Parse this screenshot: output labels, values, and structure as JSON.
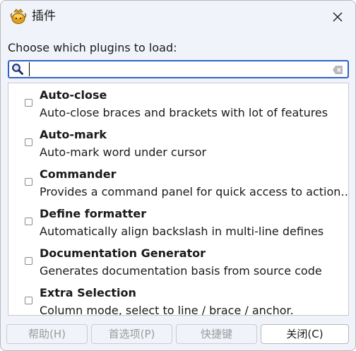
{
  "window": {
    "title": "插件",
    "close_label": "✕"
  },
  "prompt": "Choose which plugins to load:",
  "search": {
    "value": "",
    "placeholder": ""
  },
  "plugins": [
    {
      "name": "Auto-close",
      "description": "Auto-close braces and brackets with lot of features",
      "checked": false
    },
    {
      "name": "Auto-mark",
      "description": "Auto-mark word under cursor",
      "checked": false
    },
    {
      "name": "Commander",
      "description": "Provides a command panel for quick access to action…",
      "checked": false
    },
    {
      "name": "Define formatter",
      "description": "Automatically align backslash in multi-line defines",
      "checked": false
    },
    {
      "name": "Documentation Generator",
      "description": "Generates documentation basis from source code",
      "checked": false
    },
    {
      "name": "Extra Selection",
      "description": "Column mode, select to line / brace / anchor.",
      "checked": false
    }
  ],
  "buttons": {
    "help": "帮助(H)",
    "preferences": "首选项(P)",
    "keybindings": "快捷键",
    "close": "关闭(C)"
  },
  "colors": {
    "accent": "#2f64c4",
    "disabled_text": "#9b9b9b"
  }
}
